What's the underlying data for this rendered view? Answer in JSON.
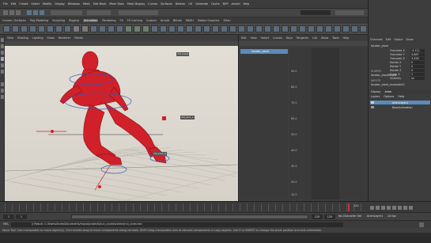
{
  "menubar": {
    "items": [
      "File",
      "Edit",
      "Create",
      "Select",
      "Modify",
      "Display",
      "Windows",
      "Mesh",
      "Edit Mesh",
      "Mesh Tools",
      "Mesh Display",
      "Curves",
      "Surfaces",
      "Deform",
      "UV",
      "Generate",
      "Cache",
      "BHP",
      "Arnold",
      "Help"
    ],
    "workspace_label": "Workspace:",
    "workspace_value": "Maya Classic"
  },
  "shelf": {
    "tabs": [
      "Curves / Surfaces",
      "Poly Modeling",
      "Sculpting",
      "Rigging",
      "Animation",
      "Rendering",
      "FX",
      "FX Caching",
      "Custom",
      "Arnold",
      "Bifrost",
      "MASH",
      "Motion Graphics",
      "XGen"
    ]
  },
  "viewport": {
    "menus": [
      "View",
      "Shading",
      "Lighting",
      "Show",
      "Renderer",
      "Panels"
    ],
    "annotations": [
      "ctrl_head",
      "ctrl_arm_L",
      "ctrl_foot_R"
    ],
    "character_color": "#d0202a"
  },
  "graph_editor": {
    "menus": [
      "Edit",
      "View",
      "Select",
      "Curves",
      "Keys",
      "Tangents",
      "List",
      "Show",
      "Tools",
      "Help"
    ],
    "selected_item": "locator_pivot",
    "ticks": [
      "90.0",
      "80.0",
      "70.0",
      "60.0",
      "50.0",
      "40.0",
      "30.0",
      "20.0",
      "10.0"
    ]
  },
  "attribute_panel": {
    "tabs": [
      "Channels",
      "Edit",
      "Object",
      "Show"
    ],
    "object_name": "locator_pivot",
    "channels": [
      {
        "name": "Translate X",
        "value": "-4.111"
      },
      {
        "name": "Translate Y",
        "value": "4.887"
      },
      {
        "name": "Translate Z",
        "value": "3.458"
      },
      {
        "name": "Rotate X",
        "value": "0"
      },
      {
        "name": "Rotate Y",
        "value": "0"
      },
      {
        "name": "Rotate Z",
        "value": "0"
      },
      {
        "name": "Scale X",
        "value": "1"
      },
      {
        "name": "Visibility",
        "value": "on"
      }
    ],
    "shapes_label": "SHAPES",
    "shape_name": "locator_pivotShape",
    "inputs_label": "INPUTS",
    "input_name": "locator_pivot_constraint1"
  },
  "layers": {
    "tabs": [
      "Display",
      "Anim"
    ],
    "menus": [
      "Layers",
      "Options",
      "Help"
    ],
    "items": [
      "AnimLayer1",
      "BaseAnimation"
    ]
  },
  "timeline": {
    "start": "1",
    "end": "120",
    "current": "120",
    "range_start": "1",
    "range_end": "120",
    "character_set": "No Character Set",
    "anim_layer": "AnimLayer1",
    "fps": "24 fps"
  },
  "cmdline": {
    "label": "MEL",
    "result": "// Result: C:/Users/Anim/Documents/maya/projects/run_cycle/scenes/run_anim.mb"
  },
  "help_line": "Move Tool: Use manipulator to move object(s). Ctrl+middle-drag to move components along normals. Shift+drag manipulator axis to extrude components or copy objects. Use D or INSERT to change the pivot position and axis orientation."
}
